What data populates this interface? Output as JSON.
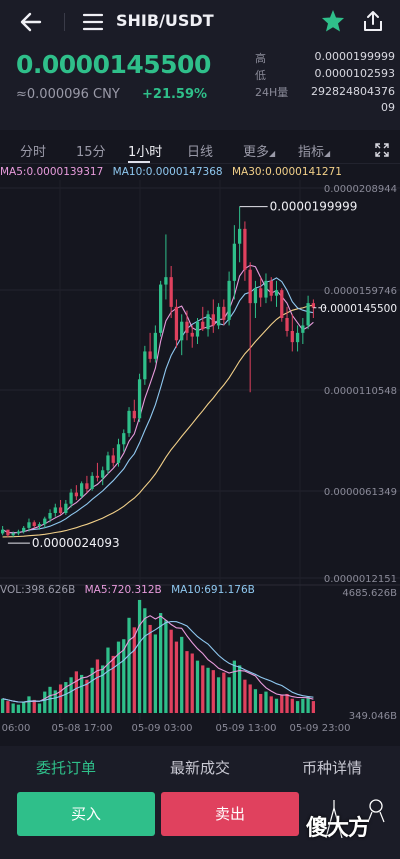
{
  "header": {
    "pair": "SHIB/USDT"
  },
  "ticker": {
    "price": "0.0000145500",
    "cny": "≈0.000096 CNY",
    "change": "+21.59%",
    "high_label": "高",
    "high": "0.0000199999",
    "low_label": "低",
    "low": "0.0000102593",
    "vol_label": "24H量",
    "vol": "29282480437609"
  },
  "tabs": {
    "t1": "分时",
    "t2": "15分",
    "t3": "1小时",
    "t4": "日线",
    "t5": "更多",
    "t6": "指标"
  },
  "ma_legend": {
    "ma5": "MA5:0.0000139317",
    "ma10": "MA10:0.0000147368",
    "ma30": "MA30:0.0000141271"
  },
  "vol_legend": {
    "vol": "VOL:398.626B",
    "ma5": "MA5:720.312B",
    "ma10": "MA10:691.176B"
  },
  "colors": {
    "up": "#2fbf8a",
    "down": "#e0415e",
    "ma5": "#e79bdc",
    "ma10": "#8fc8f0",
    "ma30": "#f2d089"
  },
  "chart_data": {
    "type": "candlestick",
    "price_axis_labels": [
      "0.0000208944",
      "0.0000159746",
      "0.0000110548",
      "0.0000061349",
      "0.0000012151"
    ],
    "price_ylim": [
      1.2151e-06,
      2.08944e-05
    ],
    "current_price_label": "0.0000145500",
    "high_annotation": "0.0000199999",
    "low_annotation": "0.0000024093",
    "volume_axis_labels": [
      "4685.626B",
      "349.046B"
    ],
    "time_labels": [
      "06:00",
      "05-08 17:00",
      "05-09 03:00",
      "05-09 13:00",
      "05-09 23:00"
    ],
    "candles": [
      [
        24,
        28,
        23,
        26
      ],
      [
        26,
        26,
        22,
        23
      ],
      [
        23,
        25,
        22,
        24
      ],
      [
        24,
        26,
        23,
        25
      ],
      [
        25,
        28,
        24,
        27
      ],
      [
        27,
        32,
        25,
        30
      ],
      [
        30,
        31,
        27,
        28
      ],
      [
        28,
        30,
        26,
        29
      ],
      [
        29,
        33,
        27,
        32
      ],
      [
        32,
        37,
        30,
        35
      ],
      [
        35,
        40,
        33,
        38
      ],
      [
        38,
        42,
        34,
        35
      ],
      [
        35,
        42,
        34,
        40
      ],
      [
        40,
        48,
        38,
        46
      ],
      [
        46,
        50,
        42,
        44
      ],
      [
        44,
        52,
        43,
        51
      ],
      [
        51,
        55,
        46,
        48
      ],
      [
        48,
        57,
        47,
        55
      ],
      [
        55,
        62,
        52,
        54
      ],
      [
        54,
        60,
        50,
        58
      ],
      [
        58,
        68,
        56,
        66
      ],
      [
        66,
        70,
        60,
        62
      ],
      [
        62,
        75,
        60,
        72
      ],
      [
        72,
        80,
        68,
        78
      ],
      [
        78,
        92,
        76,
        90
      ],
      [
        90,
        96,
        84,
        86
      ],
      [
        86,
        110,
        84,
        107
      ],
      [
        107,
        125,
        104,
        122
      ],
      [
        122,
        132,
        116,
        118
      ],
      [
        118,
        136,
        116,
        132
      ],
      [
        132,
        160,
        130,
        158
      ],
      [
        158,
        185,
        150,
        162
      ],
      [
        162,
        168,
        140,
        146
      ],
      [
        146,
        150,
        124,
        128
      ],
      [
        128,
        142,
        120,
        138
      ],
      [
        138,
        144,
        128,
        132
      ],
      [
        132,
        136,
        124,
        130
      ],
      [
        130,
        140,
        126,
        138
      ],
      [
        138,
        146,
        133,
        134
      ],
      [
        134,
        144,
        130,
        142
      ],
      [
        142,
        150,
        132,
        136
      ],
      [
        136,
        148,
        134,
        146
      ],
      [
        146,
        150,
        136,
        139
      ],
      [
        139,
        165,
        136,
        160
      ],
      [
        160,
        190,
        150,
        180
      ],
      [
        180,
        200,
        170,
        188
      ],
      [
        188,
        192,
        160,
        166
      ],
      [
        166,
        170,
        100,
        148
      ],
      [
        148,
        160,
        140,
        156
      ],
      [
        156,
        162,
        146,
        151
      ],
      [
        151,
        164,
        148,
        160
      ],
      [
        160,
        162,
        149,
        152
      ],
      [
        152,
        160,
        146,
        155
      ],
      [
        155,
        156,
        138,
        140
      ],
      [
        140,
        146,
        130,
        133
      ],
      [
        133,
        142,
        122,
        127
      ],
      [
        127,
        136,
        122,
        132
      ],
      [
        132,
        140,
        126,
        136
      ],
      [
        136,
        152,
        134,
        148
      ],
      [
        148,
        150,
        140,
        145.5
      ]
    ],
    "volumes": [
      12,
      10,
      8,
      7,
      9,
      14,
      11,
      8,
      18,
      22,
      19,
      24,
      26,
      30,
      35,
      32,
      28,
      38,
      45,
      40,
      55,
      48,
      60,
      62,
      80,
      72,
      95,
      88,
      74,
      66,
      84,
      78,
      70,
      60,
      64,
      52,
      50,
      44,
      40,
      38,
      36,
      30,
      34,
      30,
      44,
      40,
      28,
      24,
      20,
      16,
      18,
      14,
      12,
      15,
      16,
      12,
      10,
      12,
      14,
      10
    ],
    "vol_ylim": [
      0,
      100
    ]
  }
}
